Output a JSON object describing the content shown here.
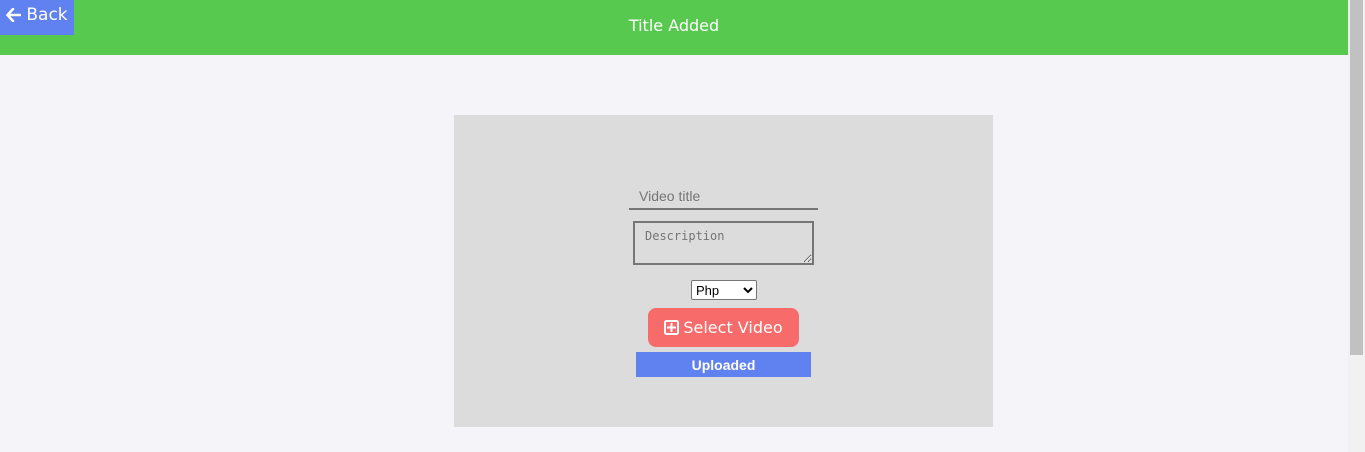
{
  "header": {
    "back_label": "Back",
    "title": "Title Added",
    "color": "#58c94f"
  },
  "form": {
    "title_placeholder": "Video title",
    "description_placeholder": "Description",
    "category_selected": "Php",
    "select_video_label": "Select Video",
    "status_text": "Uploaded"
  },
  "icons": {
    "back": "arrow-left-icon",
    "select": "plus-square-icon"
  },
  "colors": {
    "accent_blue": "#6081f0",
    "button_red": "#f76b6b",
    "card_bg": "#dcdcdc",
    "page_bg": "#f4f4f9"
  }
}
